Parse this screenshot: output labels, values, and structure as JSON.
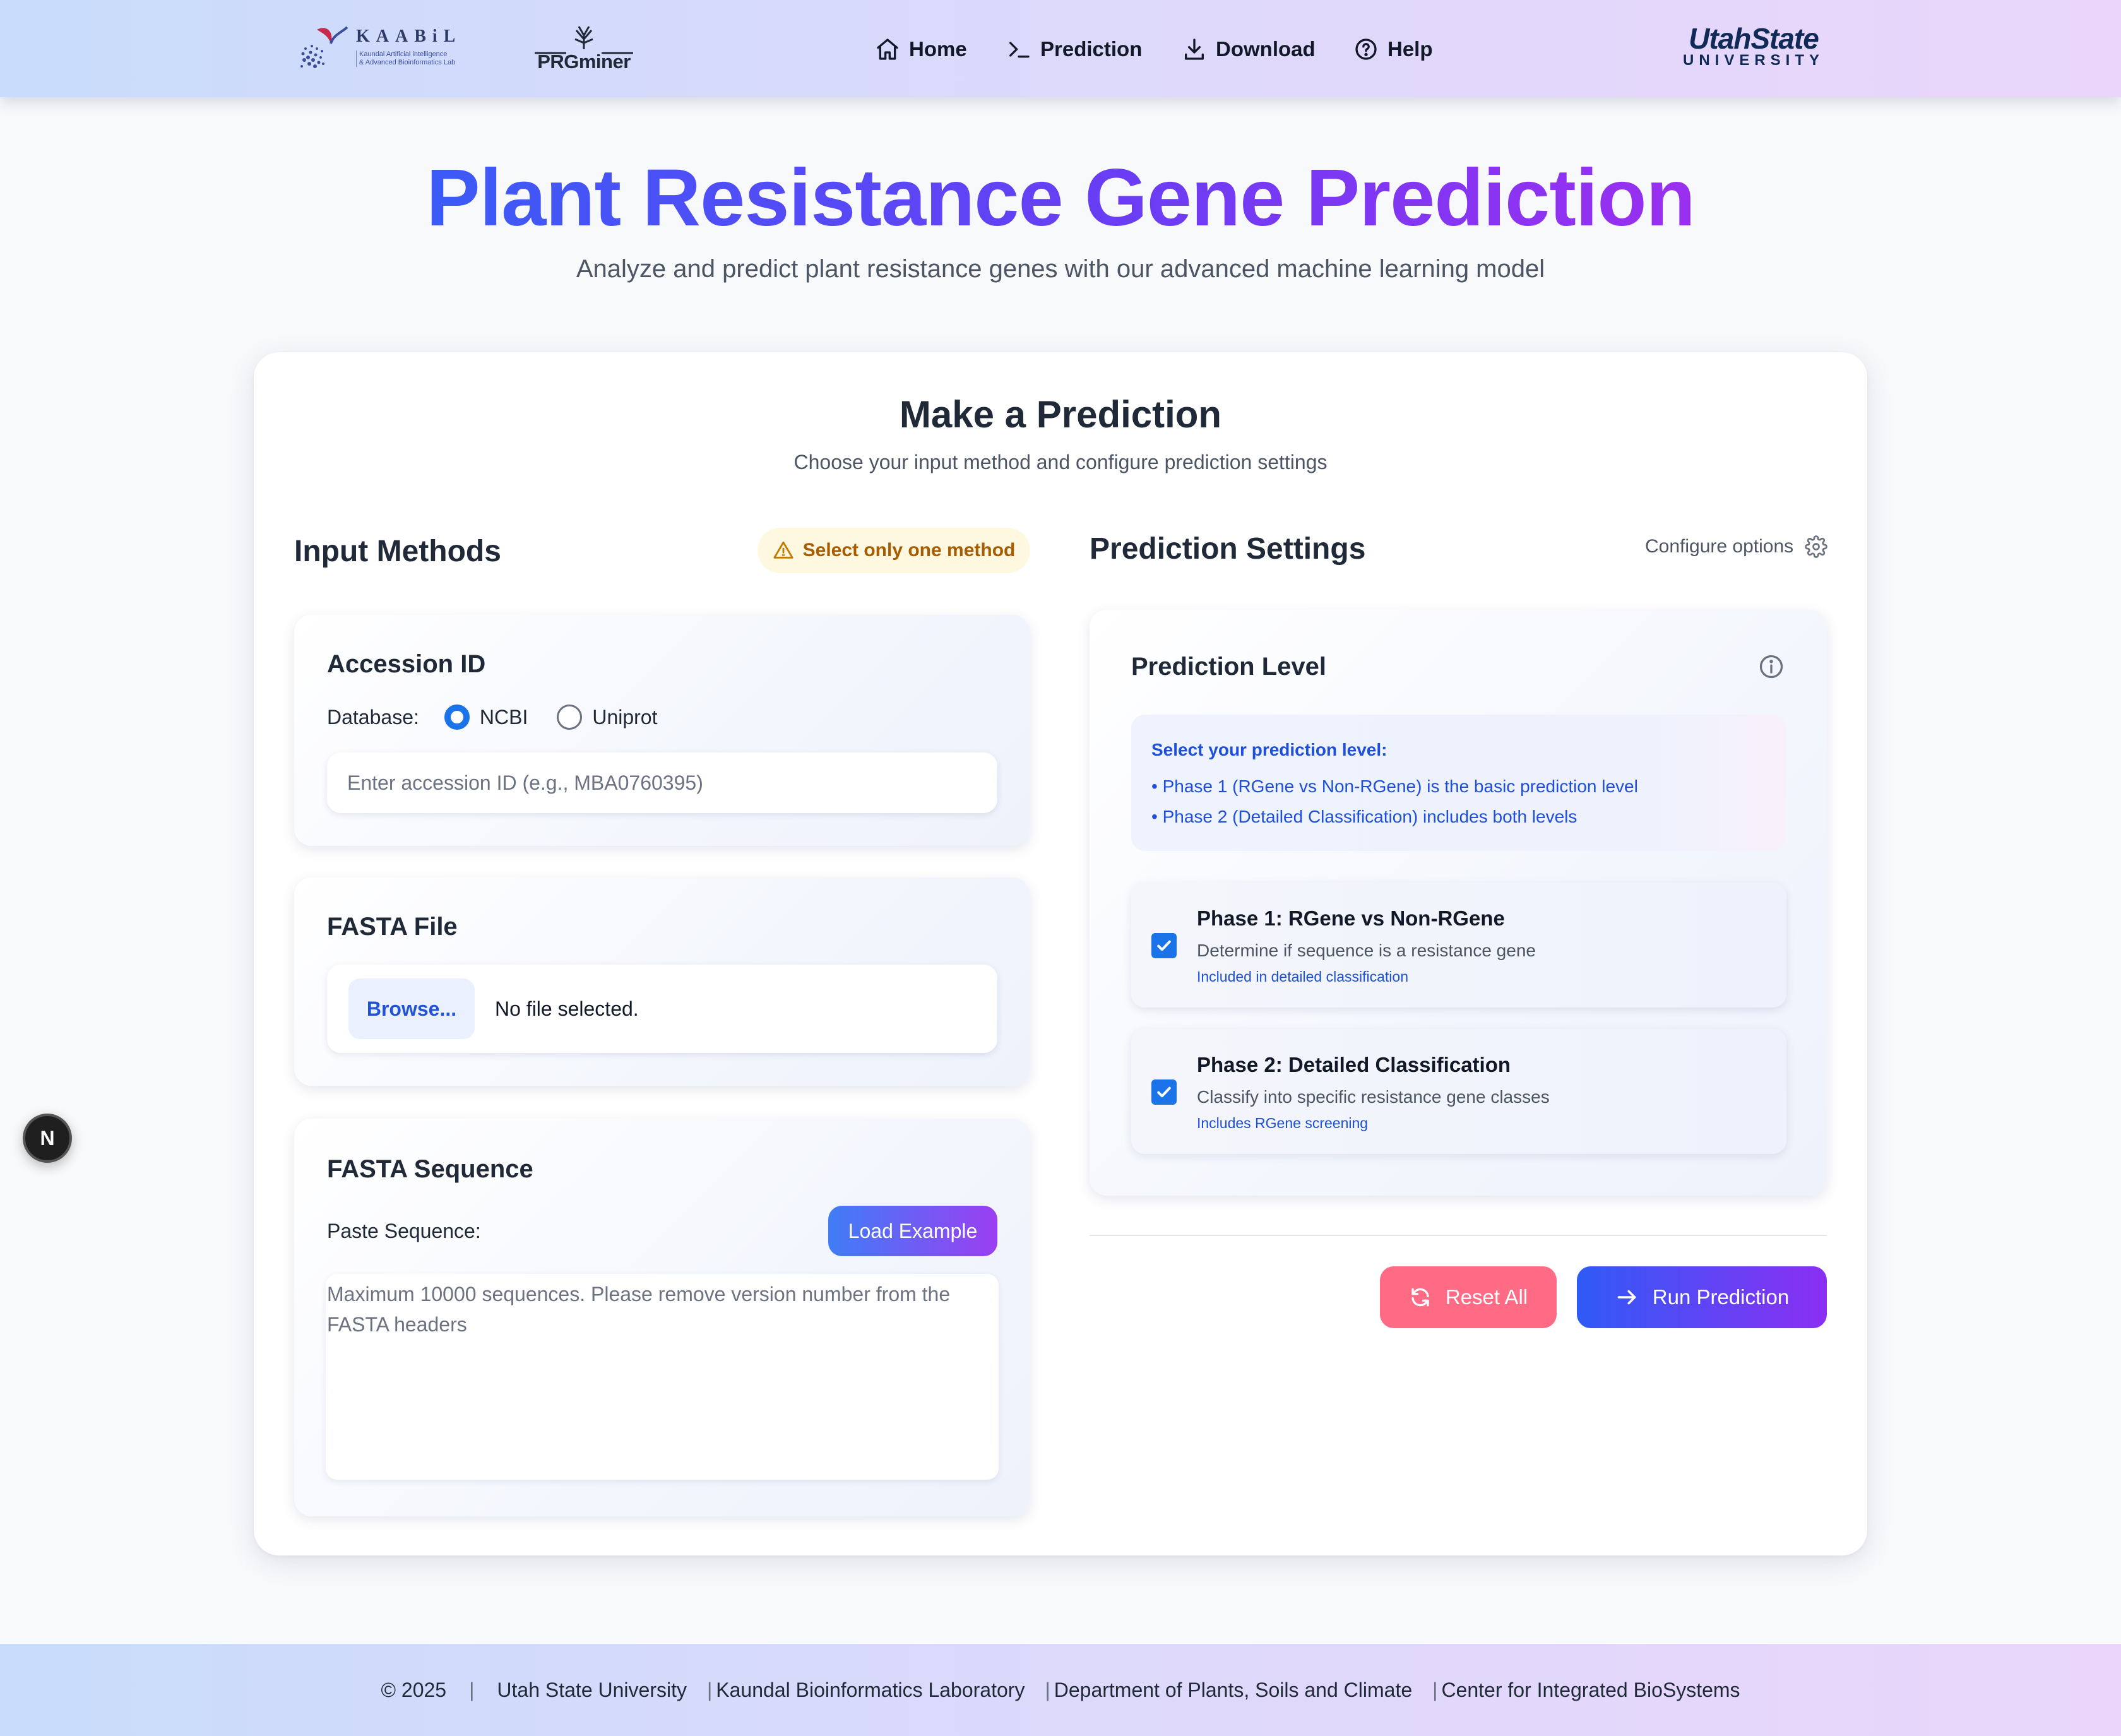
{
  "header": {
    "logo_kaabil": {
      "title": "KAABiL",
      "sub_line1": "Kaundal Artificial intelligence",
      "sub_line2": "& Advanced Bioinformatics Lab"
    },
    "logo_prg": "PRGminer",
    "nav": [
      {
        "label": "Home",
        "icon": "home-icon"
      },
      {
        "label": "Prediction",
        "icon": "terminal-icon"
      },
      {
        "label": "Download",
        "icon": "download-icon"
      },
      {
        "label": "Help",
        "icon": "help-circle-icon"
      }
    ],
    "usu_logo": {
      "top": "UtahState",
      "bottom": "UNIVERSITY"
    }
  },
  "hero": {
    "title": "Plant Resistance Gene Prediction",
    "subtitle": "Analyze and predict plant resistance genes with our advanced machine learning model"
  },
  "card": {
    "title": "Make a Prediction",
    "subtitle": "Choose your input method and configure prediction settings"
  },
  "input_methods": {
    "heading": "Input Methods",
    "warning": "Select only one method",
    "accession": {
      "title": "Accession ID",
      "db_label": "Database:",
      "options": [
        "NCBI",
        "Uniprot"
      ],
      "selected": "NCBI",
      "placeholder": "Enter accession ID (e.g., MBA0760395)"
    },
    "fasta_file": {
      "title": "FASTA File",
      "browse_label": "Browse...",
      "status": "No file selected."
    },
    "fasta_sequence": {
      "title": "FASTA Sequence",
      "paste_label": "Paste Sequence:",
      "load_example": "Load Example",
      "placeholder_line1": "Maximum 10000 sequences. Please remove version number from the",
      "placeholder_line2": "FASTA headers"
    }
  },
  "settings": {
    "heading": "Prediction Settings",
    "configure": "Configure options",
    "level": {
      "title": "Prediction Level",
      "info_title": "Select your prediction level:",
      "info_items": [
        "Phase 1 (RGene vs Non-RGene) is the basic prediction level",
        "Phase 2 (Detailed Classification) includes both levels"
      ],
      "phases": [
        {
          "title": "Phase 1: RGene vs Non-RGene",
          "desc": "Determine if sequence is a resistance gene",
          "note": "Included in detailed classification",
          "checked": true
        },
        {
          "title": "Phase 2: Detailed Classification",
          "desc": "Classify into specific resistance gene classes",
          "note": "Includes RGene screening",
          "checked": true
        }
      ]
    },
    "reset_label": "Reset All",
    "run_label": "Run Prediction"
  },
  "dev_badge": "N",
  "footer": {
    "copyright": "© 2025",
    "items": [
      "Utah State University",
      "Kaundal Bioinformatics Laboratory",
      "Department of Plants, Soils and Climate",
      "Center for Integrated BioSystems"
    ]
  },
  "colors": {
    "accent_blue": "#1a73e8",
    "title_gradient_start": "#3b5bf6",
    "title_gradient_end": "#9b2ff0",
    "reset_red": "#ff6b85",
    "warn_bg": "#fff8e1",
    "warn_text": "#a85c00"
  }
}
